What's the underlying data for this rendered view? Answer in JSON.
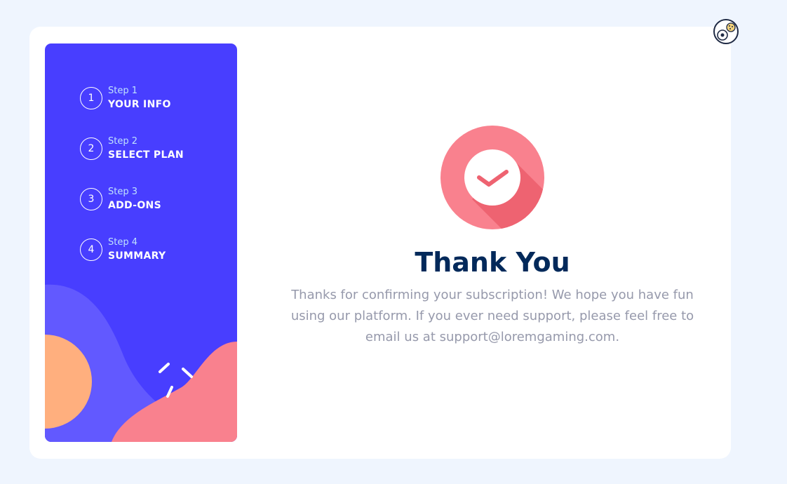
{
  "sidebar": {
    "steps": [
      {
        "number": "1",
        "label": "Step 1",
        "title": "YOUR INFO"
      },
      {
        "number": "2",
        "label": "Step 2",
        "title": "SELECT PLAN"
      },
      {
        "number": "3",
        "label": "Step 3",
        "title": "ADD-ONS"
      },
      {
        "number": "4",
        "label": "Step 4",
        "title": "SUMMARY"
      }
    ]
  },
  "main": {
    "icon": "checkmark-icon",
    "title": "Thank You",
    "message": "Thanks for confirming your subscription! We hope you have fun using our platform. If you ever need support, please feel free to email us at support@loremgaming.com."
  },
  "colors": {
    "page_bg": "#eff5fe",
    "sidebar_bg": "#483eff",
    "title": "#02295a",
    "text_muted": "#9699ab",
    "accent_pink": "#f9818e",
    "accent_orange": "#ffaf7e"
  },
  "corner_badge": {
    "icon": "user-avatar-icon"
  }
}
